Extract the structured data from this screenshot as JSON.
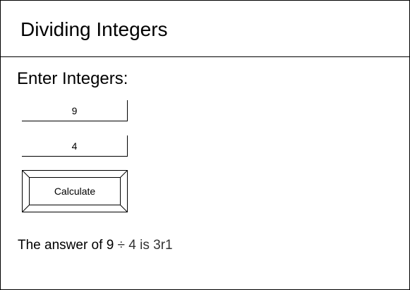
{
  "header": {
    "title": "Dividing Integers"
  },
  "form": {
    "section_label": "Enter Integers:",
    "dividend_value": "9",
    "divisor_value": "4",
    "calculate_label": "Calculate"
  },
  "result": {
    "prefix": "The answer of",
    "dividend": "9",
    "operator": "÷",
    "divisor": "4",
    "connector": "is",
    "answer": "3r1"
  }
}
